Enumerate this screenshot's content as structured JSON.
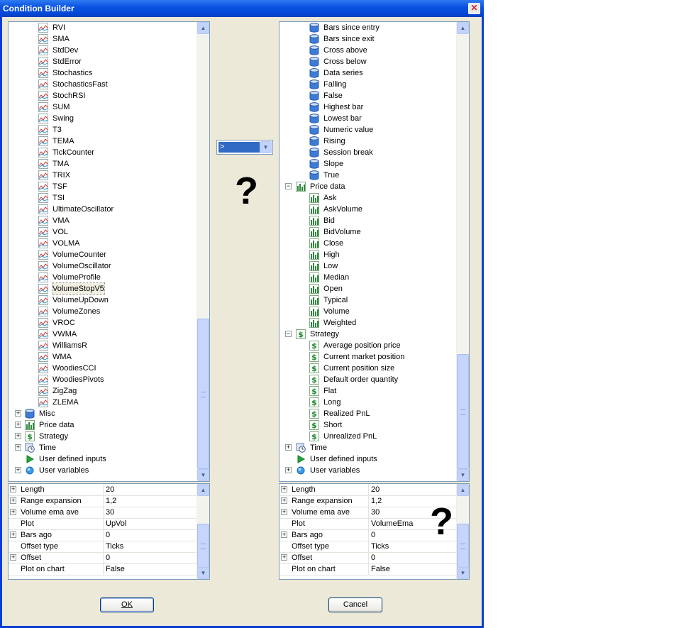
{
  "window": {
    "title": "Condition Builder",
    "close_glyph": "✕"
  },
  "left_tree": {
    "items": [
      {
        "label": "RVI",
        "icon": "indicator-icon",
        "level": 2
      },
      {
        "label": "SMA",
        "icon": "indicator-icon",
        "level": 2
      },
      {
        "label": "StdDev",
        "icon": "indicator-icon",
        "level": 2
      },
      {
        "label": "StdError",
        "icon": "indicator-icon",
        "level": 2
      },
      {
        "label": "Stochastics",
        "icon": "indicator-icon",
        "level": 2
      },
      {
        "label": "StochasticsFast",
        "icon": "indicator-icon",
        "level": 2
      },
      {
        "label": "StochRSI",
        "icon": "indicator-icon",
        "level": 2
      },
      {
        "label": "SUM",
        "icon": "indicator-icon",
        "level": 2
      },
      {
        "label": "Swing",
        "icon": "indicator-icon",
        "level": 2
      },
      {
        "label": "T3",
        "icon": "indicator-icon",
        "level": 2
      },
      {
        "label": "TEMA",
        "icon": "indicator-icon",
        "level": 2
      },
      {
        "label": "TickCounter",
        "icon": "indicator-icon",
        "level": 2
      },
      {
        "label": "TMA",
        "icon": "indicator-icon",
        "level": 2
      },
      {
        "label": "TRIX",
        "icon": "indicator-icon",
        "level": 2
      },
      {
        "label": "TSF",
        "icon": "indicator-icon",
        "level": 2
      },
      {
        "label": "TSI",
        "icon": "indicator-icon",
        "level": 2
      },
      {
        "label": "UltimateOscillator",
        "icon": "indicator-icon",
        "level": 2
      },
      {
        "label": "VMA",
        "icon": "indicator-icon",
        "level": 2
      },
      {
        "label": "VOL",
        "icon": "indicator-icon",
        "level": 2
      },
      {
        "label": "VOLMA",
        "icon": "indicator-icon",
        "level": 2
      },
      {
        "label": "VolumeCounter",
        "icon": "indicator-icon",
        "level": 2
      },
      {
        "label": "VolumeOscillator",
        "icon": "indicator-icon",
        "level": 2
      },
      {
        "label": "VolumeProfile",
        "icon": "indicator-icon",
        "level": 2
      },
      {
        "label": "VolumeStopV5",
        "icon": "indicator-icon",
        "level": 2,
        "selected": true
      },
      {
        "label": "VolumeUpDown",
        "icon": "indicator-icon",
        "level": 2
      },
      {
        "label": "VolumeZones",
        "icon": "indicator-icon",
        "level": 2
      },
      {
        "label": "VROC",
        "icon": "indicator-icon",
        "level": 2
      },
      {
        "label": "VWMA",
        "icon": "indicator-icon",
        "level": 2
      },
      {
        "label": "WilliamsR",
        "icon": "indicator-icon",
        "level": 2
      },
      {
        "label": "WMA",
        "icon": "indicator-icon",
        "level": 2
      },
      {
        "label": "WoodiesCCI",
        "icon": "indicator-icon",
        "level": 2
      },
      {
        "label": "WoodiesPivots",
        "icon": "indicator-icon",
        "level": 2
      },
      {
        "label": "ZigZag",
        "icon": "indicator-icon",
        "level": 2
      },
      {
        "label": "ZLEMA",
        "icon": "indicator-icon",
        "level": 2
      },
      {
        "label": "Misc",
        "icon": "database-icon",
        "level": 1,
        "expander": "+"
      },
      {
        "label": "Price data",
        "icon": "bar-chart-icon",
        "level": 1,
        "expander": "+"
      },
      {
        "label": "Strategy",
        "icon": "dollar-icon",
        "level": 1,
        "expander": "+"
      },
      {
        "label": "Time",
        "icon": "clock-icon",
        "level": 1,
        "expander": "+"
      },
      {
        "label": "User defined inputs",
        "icon": "play-icon",
        "level": 1
      },
      {
        "label": "User variables",
        "icon": "globe-icon",
        "level": 1,
        "expander": "+"
      }
    ]
  },
  "right_tree": {
    "items": [
      {
        "label": "Bars since entry",
        "icon": "database-icon",
        "level": 2
      },
      {
        "label": "Bars since exit",
        "icon": "database-icon",
        "level": 2
      },
      {
        "label": "Cross above",
        "icon": "database-icon",
        "level": 2
      },
      {
        "label": "Cross below",
        "icon": "database-icon",
        "level": 2
      },
      {
        "label": "Data series",
        "icon": "database-icon",
        "level": 2
      },
      {
        "label": "Falling",
        "icon": "database-icon",
        "level": 2
      },
      {
        "label": "False",
        "icon": "database-icon",
        "level": 2
      },
      {
        "label": "Highest bar",
        "icon": "database-icon",
        "level": 2
      },
      {
        "label": "Lowest bar",
        "icon": "database-icon",
        "level": 2
      },
      {
        "label": "Numeric value",
        "icon": "database-icon",
        "level": 2
      },
      {
        "label": "Rising",
        "icon": "database-icon",
        "level": 2
      },
      {
        "label": "Session break",
        "icon": "database-icon",
        "level": 2
      },
      {
        "label": "Slope",
        "icon": "database-icon",
        "level": 2
      },
      {
        "label": "True",
        "icon": "database-icon",
        "level": 2
      },
      {
        "label": "Price data",
        "icon": "bar-chart-icon",
        "level": 1,
        "expander": "−"
      },
      {
        "label": "Ask",
        "icon": "bar-chart-icon",
        "level": 2
      },
      {
        "label": "AskVolume",
        "icon": "bar-chart-icon",
        "level": 2
      },
      {
        "label": "Bid",
        "icon": "bar-chart-icon",
        "level": 2
      },
      {
        "label": "BidVolume",
        "icon": "bar-chart-icon",
        "level": 2
      },
      {
        "label": "Close",
        "icon": "bar-chart-icon",
        "level": 2
      },
      {
        "label": "High",
        "icon": "bar-chart-icon",
        "level": 2
      },
      {
        "label": "Low",
        "icon": "bar-chart-icon",
        "level": 2
      },
      {
        "label": "Median",
        "icon": "bar-chart-icon",
        "level": 2
      },
      {
        "label": "Open",
        "icon": "bar-chart-icon",
        "level": 2
      },
      {
        "label": "Typical",
        "icon": "bar-chart-icon",
        "level": 2
      },
      {
        "label": "Volume",
        "icon": "bar-chart-icon",
        "level": 2
      },
      {
        "label": "Weighted",
        "icon": "bar-chart-icon",
        "level": 2
      },
      {
        "label": "Strategy",
        "icon": "dollar-icon",
        "level": 1,
        "expander": "−"
      },
      {
        "label": "Average position price",
        "icon": "dollar-icon",
        "level": 2
      },
      {
        "label": "Current market position",
        "icon": "dollar-icon",
        "level": 2
      },
      {
        "label": "Current position size",
        "icon": "dollar-icon",
        "level": 2
      },
      {
        "label": "Default order quantity",
        "icon": "dollar-icon",
        "level": 2
      },
      {
        "label": "Flat",
        "icon": "dollar-icon",
        "level": 2
      },
      {
        "label": "Long",
        "icon": "dollar-icon",
        "level": 2
      },
      {
        "label": "Realized PnL",
        "icon": "dollar-icon",
        "level": 2
      },
      {
        "label": "Short",
        "icon": "dollar-icon",
        "level": 2
      },
      {
        "label": "Unrealized PnL",
        "icon": "dollar-icon",
        "level": 2
      },
      {
        "label": "Time",
        "icon": "clock-icon",
        "level": 1,
        "expander": "+"
      },
      {
        "label": "User defined inputs",
        "icon": "play-icon",
        "level": 1
      },
      {
        "label": "User variables",
        "icon": "globe-icon",
        "level": 1,
        "expander": "+"
      }
    ]
  },
  "operator": {
    "value": ">",
    "dropdown_glyph": "▼"
  },
  "question_marks": [
    "?",
    "?"
  ],
  "left_props": [
    {
      "name": "Length",
      "value": "20",
      "expander": true
    },
    {
      "name": "Range expansion",
      "value": "1,2",
      "expander": true
    },
    {
      "name": "Volume ema ave",
      "value": "30",
      "expander": true
    },
    {
      "name": "Plot",
      "value": "UpVol",
      "expander": false
    },
    {
      "name": "Bars ago",
      "value": "0",
      "expander": true
    },
    {
      "name": "Offset type",
      "value": "Ticks",
      "expander": false
    },
    {
      "name": "Offset",
      "value": "0",
      "expander": true
    },
    {
      "name": "Plot on chart",
      "value": "False",
      "expander": false
    }
  ],
  "right_props": [
    {
      "name": "Length",
      "value": "20",
      "expander": true
    },
    {
      "name": "Range expansion",
      "value": "1,2",
      "expander": true
    },
    {
      "name": "Volume ema ave",
      "value": "30",
      "expander": true
    },
    {
      "name": "Plot",
      "value": "VolumeEma",
      "expander": false
    },
    {
      "name": "Bars ago",
      "value": "0",
      "expander": true
    },
    {
      "name": "Offset type",
      "value": "Ticks",
      "expander": false
    },
    {
      "name": "Offset",
      "value": "0",
      "expander": true
    },
    {
      "name": "Plot on chart",
      "value": "False",
      "expander": false
    }
  ],
  "buttons": {
    "ok": "OK",
    "cancel": "Cancel"
  },
  "scroll_glyphs": {
    "up": "▲",
    "down": "▼"
  },
  "colors": {
    "title_bar": "#0a54e2",
    "dialog_bg": "#ece9d8",
    "selection": "#316ac5"
  }
}
